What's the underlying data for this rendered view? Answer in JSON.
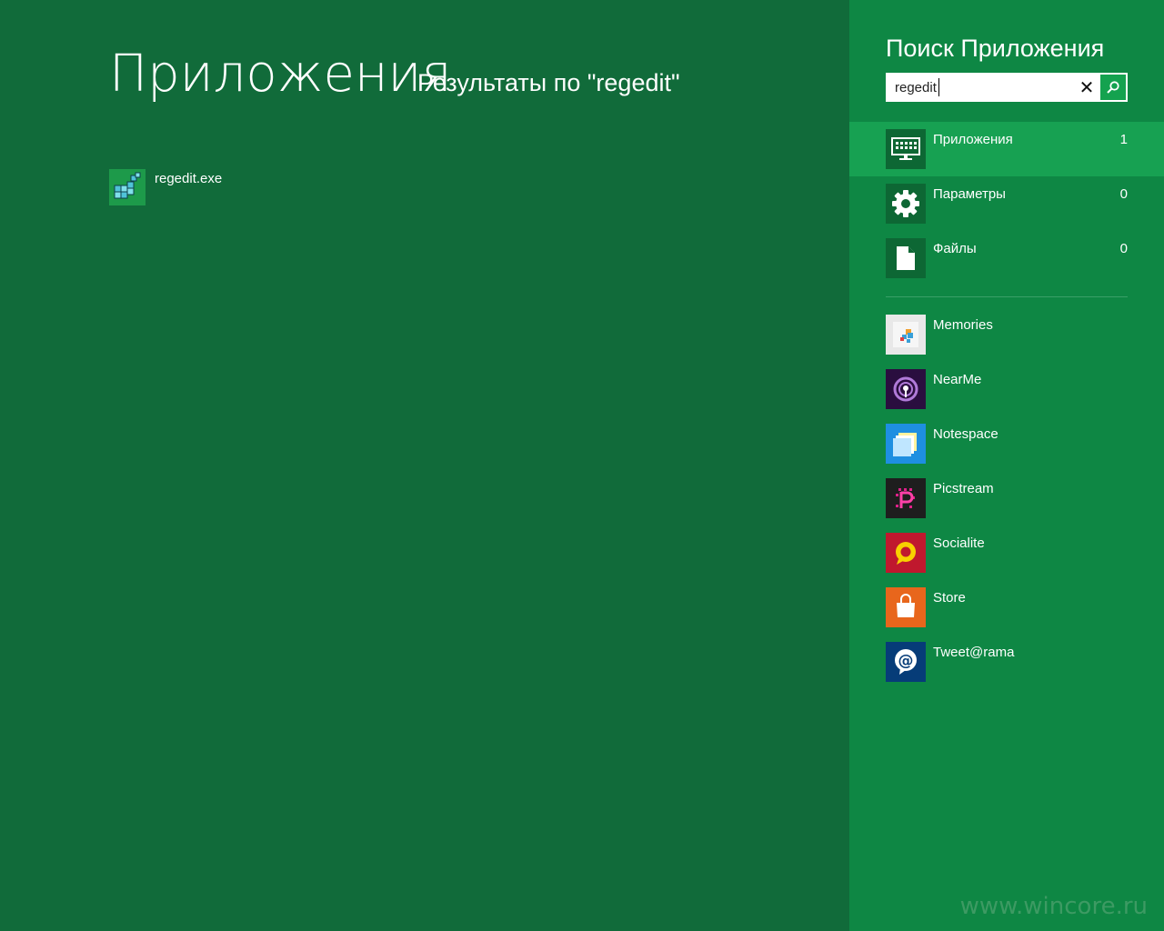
{
  "main": {
    "title": "Приложения",
    "subtitle": "Результаты по \"regedit\"",
    "results": [
      {
        "label": "regedit.exe",
        "icon": "regedit-icon"
      }
    ]
  },
  "pane": {
    "title": "Поиск Приложения",
    "search": {
      "value": "regedit",
      "clear_icon": "close-icon",
      "go_icon": "search-icon"
    },
    "scopes": [
      {
        "label": "Приложения",
        "count": "1",
        "icon": "monitor-icon",
        "active": true
      },
      {
        "label": "Параметры",
        "count": "0",
        "icon": "gear-icon",
        "active": false
      },
      {
        "label": "Файлы",
        "count": "0",
        "icon": "document-icon",
        "active": false
      }
    ],
    "apps": [
      {
        "label": "Memories",
        "icon": "memories-icon",
        "color": "#e8e8e8"
      },
      {
        "label": "NearMe",
        "icon": "nearme-icon",
        "color": "#2a0e3f"
      },
      {
        "label": "Notespace",
        "icon": "notespace-icon",
        "color": "#1e8fe1"
      },
      {
        "label": "Picstream",
        "icon": "picstream-icon",
        "color": "#1e1e1e"
      },
      {
        "label": "Socialite",
        "icon": "socialite-icon",
        "color": "#c0182e"
      },
      {
        "label": "Store",
        "icon": "store-icon",
        "color": "#e8661c"
      },
      {
        "label": "Tweet@rama",
        "icon": "tweetarama-icon",
        "color": "#063c78"
      }
    ]
  },
  "watermark": "www.wincore.ru",
  "colors": {
    "background": "#116b3a",
    "pane": "#0e8744",
    "active_scope": "#17a152"
  }
}
